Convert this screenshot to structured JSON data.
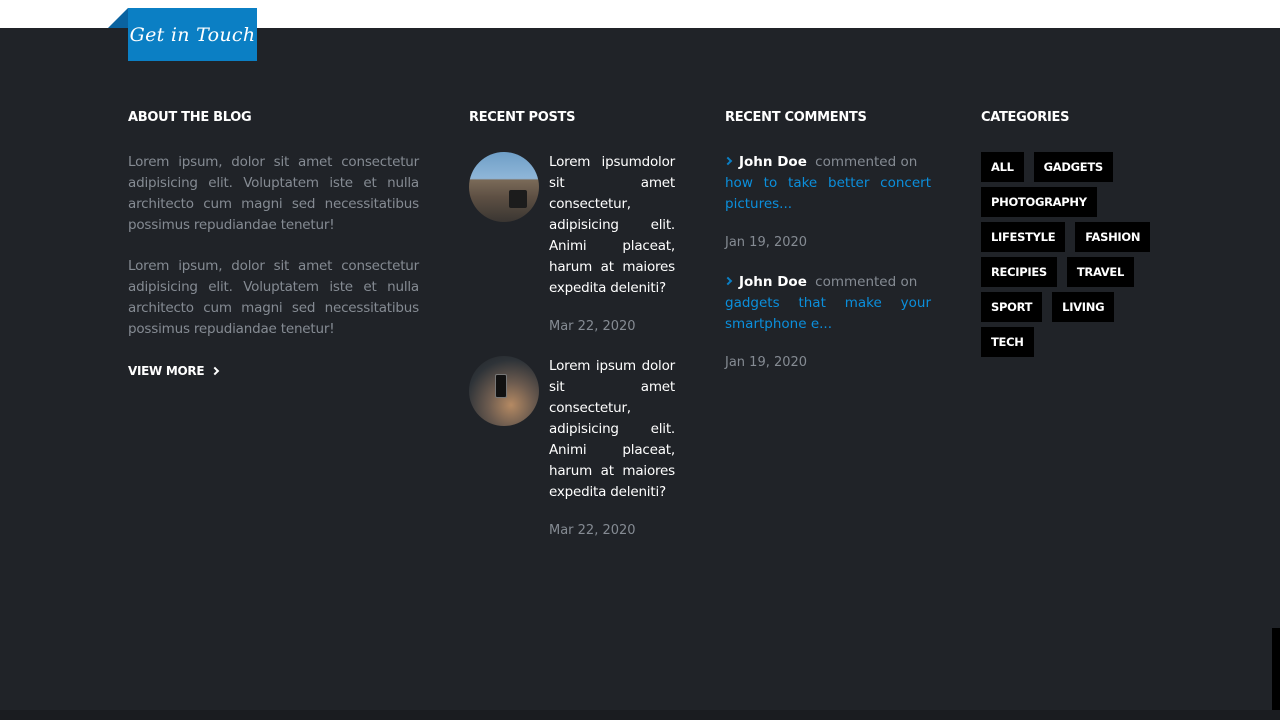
{
  "header": {
    "get_in_touch": "Get in Touch"
  },
  "about": {
    "heading": "ABOUT THE BLOG",
    "paragraphs": [
      "Lorem ipsum, dolor sit amet consectetur adipisicing elit. Voluptatem iste et nulla architecto cum magni sed necessitatibus possimus repudiandae tenetur!",
      "Lorem ipsum, dolor sit amet consectetur adipisicing elit. Voluptatem iste et nulla architecto cum magni sed necessitatibus possimus repudiandae tenetur!"
    ],
    "view_more": "VIEW MORE"
  },
  "recent_posts": {
    "heading": "RECENT POSTS",
    "items": [
      {
        "title": "Lorem ipsumdolor sit amet consectetur, adipisicing elit. Animi placeat, harum at maiores expedita deleniti?",
        "date": "Mar 22, 2020"
      },
      {
        "title": "Lorem ipsum dolor sit amet consectetur, adipisicing elit. Animi placeat, harum at maiores expedita deleniti?",
        "date": "Mar 22, 2020"
      }
    ]
  },
  "recent_comments": {
    "heading": "RECENT COMMENTS",
    "items": [
      {
        "author": "John Doe",
        "action": "commented on",
        "link": "how to take better concert pictures...",
        "date": "Jan 19, 2020"
      },
      {
        "author": "John Doe",
        "action": "commented on",
        "link": "gadgets that make your smartphone e...",
        "date": "Jan 19, 2020"
      }
    ]
  },
  "categories": {
    "heading": "CATEGORIES",
    "tags": [
      "ALL",
      "GADGETS",
      "PHOTOGRAPHY",
      "LIFESTYLE",
      "FASHION",
      "RECIPIES",
      "TRAVEL",
      "SPORT",
      "LIVING",
      "TECH"
    ]
  },
  "colors": {
    "background": "#202328",
    "accent": "#0b7fc4",
    "link": "#0b8fdc",
    "muted_text": "#858b93",
    "tag_bg": "#000000"
  }
}
